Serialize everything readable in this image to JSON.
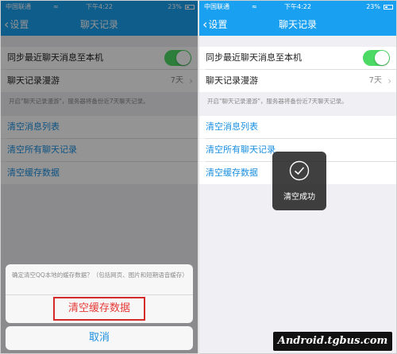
{
  "status_bar": {
    "carrier": "中国联通",
    "wifi": "≈",
    "time": "下午4:22",
    "battery": "23%"
  },
  "navbar": {
    "back_label": "设置",
    "title": "聊天记录"
  },
  "settings": {
    "sync_label": "同步最近聊天消息至本机",
    "sync_enabled": true,
    "roaming_label": "聊天记录漫游",
    "roaming_value": "7天",
    "roaming_note": "开启\"聊天记录漫游\"，服务器将备份近7天聊天记录。",
    "clear_list": "清空消息列表",
    "clear_all": "清空所有聊天记录",
    "clear_cache": "清空缓存数据"
  },
  "action_sheet": {
    "message": "确定清空QQ本地的缓存数据？（包括网页、图片和短期语音缓存）",
    "confirm": "清空缓存数据",
    "cancel": "取消"
  },
  "toast": {
    "message": "清空成功"
  },
  "watermark": "Android.tgbus.com",
  "colors": {
    "brand": "#1aa0f0",
    "toggle_on": "#4cd964",
    "link": "#1a8fe0",
    "highlight": "#d42a2a"
  }
}
